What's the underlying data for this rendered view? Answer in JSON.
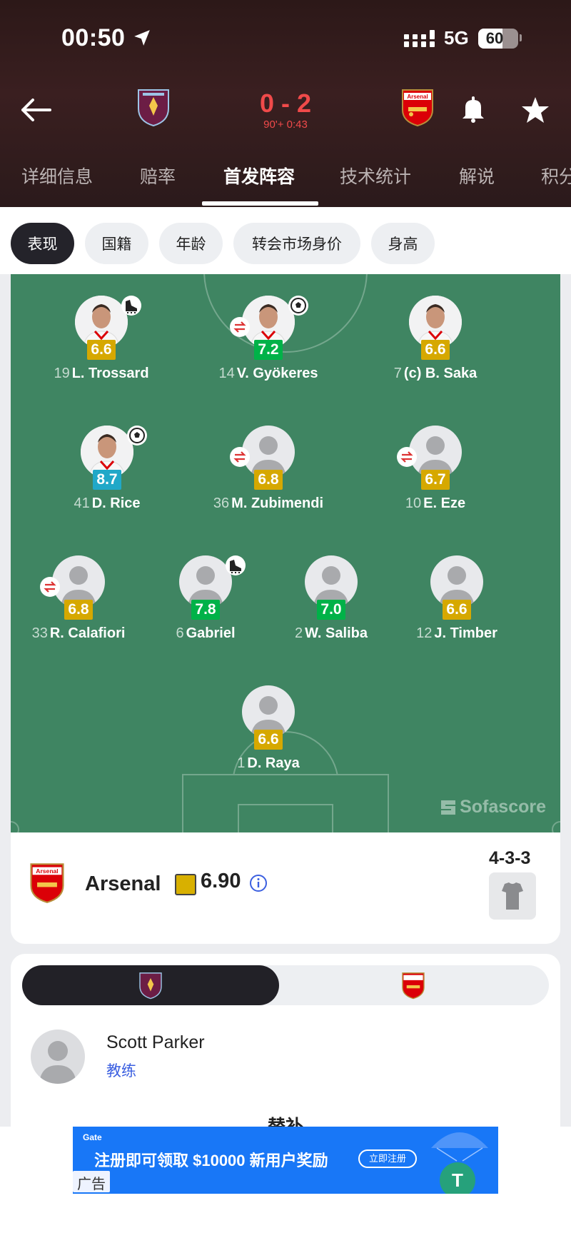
{
  "status_bar": {
    "time": "00:50",
    "network": "5G",
    "battery": "60",
    "battery_level": 0.6
  },
  "match": {
    "home_score": "0",
    "separator": "-",
    "away_score": "2",
    "score_text": "0 - 2",
    "minute": "90'+ 0:43"
  },
  "tabs": [
    {
      "label": "详细信息",
      "active": false
    },
    {
      "label": "赔率",
      "active": false
    },
    {
      "label": "首发阵容",
      "active": true
    },
    {
      "label": "技术统计",
      "active": false
    },
    {
      "label": "解说",
      "active": false
    },
    {
      "label": "积分",
      "active": false
    }
  ],
  "chips": [
    {
      "label": "表现",
      "active": true
    },
    {
      "label": "国籍",
      "active": false
    },
    {
      "label": "年龄",
      "active": false
    },
    {
      "label": "转会市场身价",
      "active": false
    },
    {
      "label": "身高",
      "active": false
    }
  ],
  "colors": {
    "rating_yellow": "#d6a800",
    "rating_green": "#00b248",
    "rating_teal": "#20a8c8",
    "pitch": "#3f8562",
    "score_red": "#f04a4a"
  },
  "players": [
    {
      "number": "19",
      "name": "L. Trossard",
      "rating": "6.6",
      "tier": "yellow",
      "icon": "boot-icon",
      "photo": true
    },
    {
      "number": "14",
      "name": "V. Gyökeres",
      "rating": "7.2",
      "tier": "green",
      "icon": "ball-icon",
      "sub": true,
      "photo": true
    },
    {
      "number": "7",
      "name": "(c) B. Saka",
      "rating": "6.6",
      "tier": "yellow",
      "photo": true
    },
    {
      "number": "41",
      "name": "D. Rice",
      "rating": "8.7",
      "tier": "teal",
      "icon": "ball-icon",
      "photo": true
    },
    {
      "number": "36",
      "name": "M. Zubimendi",
      "rating": "6.8",
      "tier": "yellow",
      "sub": true
    },
    {
      "number": "10",
      "name": "E. Eze",
      "rating": "6.7",
      "tier": "yellow",
      "sub": true
    },
    {
      "number": "33",
      "name": "R. Calafiori",
      "rating": "6.8",
      "tier": "yellow",
      "sub": true
    },
    {
      "number": "6",
      "name": "Gabriel",
      "rating": "7.8",
      "tier": "green",
      "icon": "boot-icon"
    },
    {
      "number": "2",
      "name": "W. Saliba",
      "rating": "7.0",
      "tier": "green"
    },
    {
      "number": "12",
      "name": "J. Timber",
      "rating": "6.6",
      "tier": "yellow"
    },
    {
      "number": "1",
      "name": "D. Raya",
      "rating": "6.6",
      "tier": "yellow"
    }
  ],
  "watermark": "Sofascore",
  "team_summary": {
    "name": "Arsenal",
    "rating": "6.90",
    "formation": "4-3-3"
  },
  "coach": {
    "name": "Scott Parker",
    "role": "教练"
  },
  "subs_title": "替补",
  "ad": {
    "brand": "Gate",
    "text": "注册即可领取 $10000 新用户奖励",
    "button": "立即注册",
    "label": "广告"
  }
}
